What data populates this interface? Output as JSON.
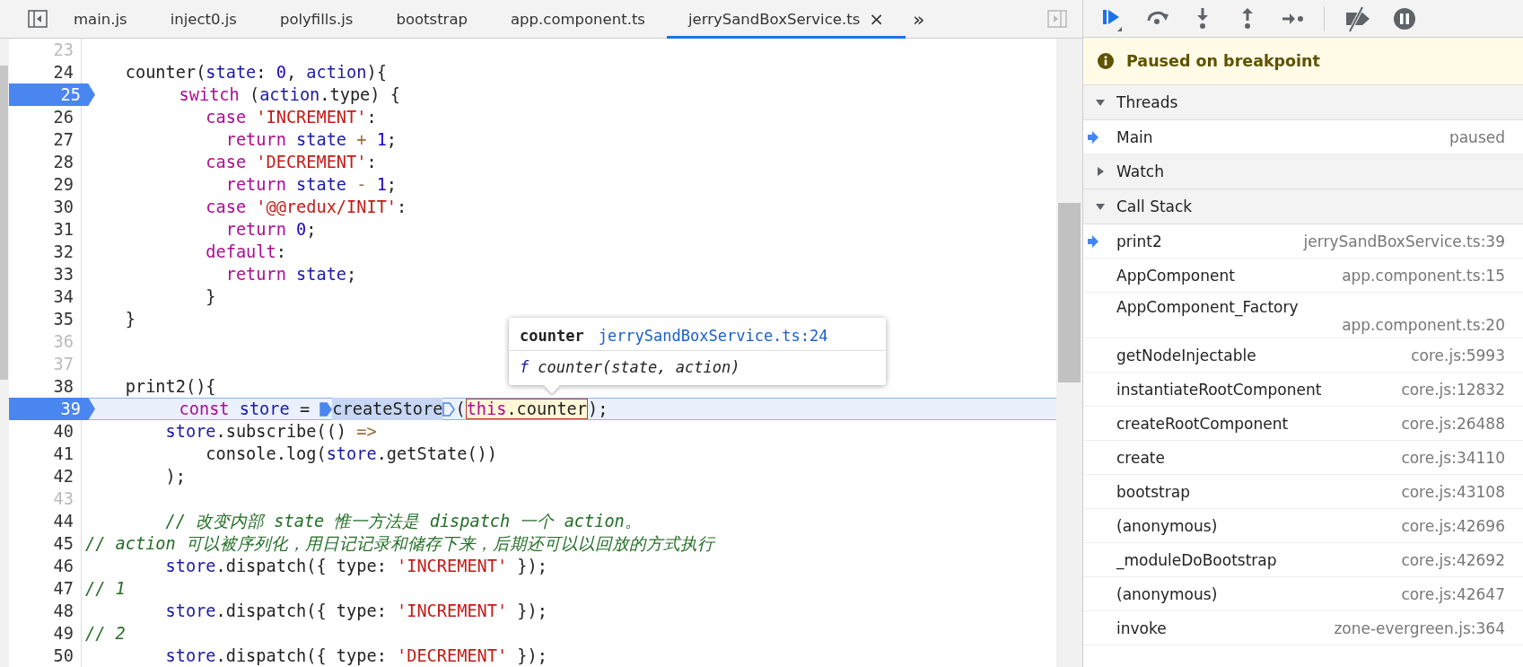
{
  "tabs": [
    {
      "label": "main.js",
      "selected": false
    },
    {
      "label": "inject0.js",
      "selected": false
    },
    {
      "label": "polyfills.js",
      "selected": false
    },
    {
      "label": "bootstrap",
      "selected": false
    },
    {
      "label": "app.component.ts",
      "selected": false
    },
    {
      "label": "jerrySandBoxService.ts",
      "selected": true
    }
  ],
  "tab_close": "×",
  "tab_overflow": "»",
  "code_lines": [
    {
      "number": "23",
      "dim": true,
      "breakpoint": false,
      "current": false
    },
    {
      "number": "24",
      "dim": false,
      "breakpoint": false,
      "current": false,
      "tokens": [
        {
          "kind": "plain",
          "text": "    counter("
        },
        {
          "kind": "variable",
          "text": "state"
        },
        {
          "kind": "plain",
          "text": ": "
        },
        {
          "kind": "number",
          "text": "0"
        },
        {
          "kind": "plain",
          "text": ", "
        },
        {
          "kind": "variable",
          "text": "action"
        },
        {
          "kind": "plain",
          "text": "){"
        }
      ]
    },
    {
      "number": "25",
      "dim": false,
      "breakpoint": true,
      "current": false,
      "tokens": [
        {
          "kind": "keyword",
          "text": "        switch"
        },
        {
          "kind": "plain",
          "text": " ("
        },
        {
          "kind": "variable",
          "text": "action"
        },
        {
          "kind": "plain",
          "text": ".type) {"
        }
      ]
    },
    {
      "number": "26",
      "dim": false,
      "breakpoint": false,
      "current": false,
      "tokens": [
        {
          "kind": "keyword",
          "text": "            case"
        },
        {
          "kind": "string",
          "text": " 'INCREMENT'"
        },
        {
          "kind": "plain",
          "text": ":"
        }
      ]
    },
    {
      "number": "27",
      "dim": false,
      "breakpoint": false,
      "current": false,
      "tokens": [
        {
          "kind": "keyword",
          "text": "              return"
        },
        {
          "kind": "variable",
          "text": " state"
        },
        {
          "kind": "operator",
          "text": " +"
        },
        {
          "kind": "number",
          "text": " 1"
        },
        {
          "kind": "plain",
          "text": ";"
        }
      ]
    },
    {
      "number": "28",
      "dim": false,
      "breakpoint": false,
      "current": false,
      "tokens": [
        {
          "kind": "keyword",
          "text": "            case"
        },
        {
          "kind": "string",
          "text": " 'DECREMENT'"
        },
        {
          "kind": "plain",
          "text": ":"
        }
      ]
    },
    {
      "number": "29",
      "dim": false,
      "breakpoint": false,
      "current": false,
      "tokens": [
        {
          "kind": "keyword",
          "text": "              return"
        },
        {
          "kind": "variable",
          "text": " state"
        },
        {
          "kind": "operator",
          "text": " -"
        },
        {
          "kind": "number",
          "text": " 1"
        },
        {
          "kind": "plain",
          "text": ";"
        }
      ]
    },
    {
      "number": "30",
      "dim": false,
      "breakpoint": false,
      "current": false,
      "tokens": [
        {
          "kind": "keyword",
          "text": "            case"
        },
        {
          "kind": "string",
          "text": " '@@redux/INIT'"
        },
        {
          "kind": "plain",
          "text": ":"
        }
      ]
    },
    {
      "number": "31",
      "dim": false,
      "breakpoint": false,
      "current": false,
      "tokens": [
        {
          "kind": "keyword",
          "text": "              return"
        },
        {
          "kind": "number",
          "text": " 0"
        },
        {
          "kind": "plain",
          "text": ";"
        }
      ]
    },
    {
      "number": "32",
      "dim": false,
      "breakpoint": false,
      "current": false,
      "tokens": [
        {
          "kind": "keyword",
          "text": "            default"
        },
        {
          "kind": "plain",
          "text": ":"
        }
      ]
    },
    {
      "number": "33",
      "dim": false,
      "breakpoint": false,
      "current": false,
      "tokens": [
        {
          "kind": "keyword",
          "text": "              return"
        },
        {
          "kind": "variable",
          "text": " state"
        },
        {
          "kind": "plain",
          "text": ";"
        }
      ]
    },
    {
      "number": "34",
      "dim": false,
      "breakpoint": false,
      "current": false,
      "tokens": [
        {
          "kind": "plain",
          "text": "            }"
        }
      ]
    },
    {
      "number": "35",
      "dim": false,
      "breakpoint": false,
      "current": false,
      "tokens": [
        {
          "kind": "plain",
          "text": "    }"
        }
      ]
    },
    {
      "number": "36",
      "dim": true,
      "breakpoint": false,
      "current": false
    },
    {
      "number": "37",
      "dim": true,
      "breakpoint": false,
      "current": false
    },
    {
      "number": "38",
      "dim": false,
      "breakpoint": false,
      "current": false,
      "tokens": [
        {
          "kind": "plain",
          "text": "    print2(){"
        }
      ]
    },
    {
      "number": "39",
      "dim": false,
      "breakpoint": true,
      "current": true,
      "tokens": [
        {
          "kind": "keyword",
          "text": "        const"
        },
        {
          "kind": "variable",
          "text": " store"
        },
        {
          "kind": "plain",
          "text": " = "
        },
        {
          "kind": "breakpoint_marker",
          "active": true
        },
        {
          "kind": "plain",
          "text": "createStore",
          "highlighted": true
        },
        {
          "kind": "breakpoint_marker",
          "active": false
        },
        {
          "kind": "plain",
          "text": "("
        },
        {
          "kind": "hovered",
          "parts": [
            {
              "kind": "keyword",
              "text": "this"
            },
            {
              "kind": "plain",
              "text": ".counter"
            }
          ]
        },
        {
          "kind": "plain",
          "text": ");"
        }
      ]
    },
    {
      "number": "40",
      "dim": false,
      "breakpoint": false,
      "current": false,
      "tokens": [
        {
          "kind": "variable",
          "text": "        store"
        },
        {
          "kind": "plain",
          "text": ".subscribe(() "
        },
        {
          "kind": "operator",
          "text": "=>"
        }
      ]
    },
    {
      "number": "41",
      "dim": false,
      "breakpoint": false,
      "current": false,
      "tokens": [
        {
          "kind": "plain",
          "text": "            console.log("
        },
        {
          "kind": "variable",
          "text": "store"
        },
        {
          "kind": "plain",
          "text": ".getState())"
        }
      ]
    },
    {
      "number": "42",
      "dim": false,
      "breakpoint": false,
      "current": false,
      "tokens": [
        {
          "kind": "plain",
          "text": "        );"
        }
      ]
    },
    {
      "number": "43",
      "dim": true,
      "breakpoint": false,
      "current": false
    },
    {
      "number": "44",
      "dim": false,
      "breakpoint": false,
      "current": false,
      "tokens": [
        {
          "kind": "comment",
          "text": "        // 改变内部 state 惟一方法是 dispatch 一个 action。"
        }
      ]
    },
    {
      "number": "45",
      "dim": false,
      "breakpoint": false,
      "current": false,
      "tokens": [
        {
          "kind": "comment",
          "text": "// action 可以被序列化，用日记记录和储存下来，后期还可以以回放的方式执行"
        }
      ]
    },
    {
      "number": "46",
      "dim": false,
      "breakpoint": false,
      "current": false,
      "tokens": [
        {
          "kind": "variable",
          "text": "        store"
        },
        {
          "kind": "plain",
          "text": ".dispatch({ type: "
        },
        {
          "kind": "string",
          "text": "'INCREMENT'"
        },
        {
          "kind": "plain",
          "text": " });"
        }
      ]
    },
    {
      "number": "47",
      "dim": false,
      "breakpoint": false,
      "current": false,
      "tokens": [
        {
          "kind": "comment",
          "text": "// 1"
        }
      ]
    },
    {
      "number": "48",
      "dim": false,
      "breakpoint": false,
      "current": false,
      "tokens": [
        {
          "kind": "variable",
          "text": "        store"
        },
        {
          "kind": "plain",
          "text": ".dispatch({ type: "
        },
        {
          "kind": "string",
          "text": "'INCREMENT'"
        },
        {
          "kind": "plain",
          "text": " });"
        }
      ]
    },
    {
      "number": "49",
      "dim": false,
      "breakpoint": false,
      "current": false,
      "tokens": [
        {
          "kind": "comment",
          "text": "// 2"
        }
      ]
    },
    {
      "number": "50",
      "dim": false,
      "breakpoint": false,
      "current": false,
      "tokens": [
        {
          "kind": "variable",
          "text": "        store"
        },
        {
          "kind": "plain",
          "text": ".dispatch({ type: "
        },
        {
          "kind": "string",
          "text": "'DECREMENT'"
        },
        {
          "kind": "plain",
          "text": " });"
        }
      ]
    }
  ],
  "tooltip": {
    "name": "counter",
    "location": "jerrySandBoxService.ts:24",
    "function_mark": "f",
    "signature": "counter(state, action)"
  },
  "debugger": {
    "toolbar": [
      {
        "kind": "resume"
      },
      {
        "kind": "step_over"
      },
      {
        "kind": "step_into"
      },
      {
        "kind": "step_out"
      },
      {
        "kind": "step"
      },
      {
        "kind": "separator"
      },
      {
        "kind": "deactivate"
      },
      {
        "kind": "pause_exceptions"
      }
    ],
    "banner": "Paused on breakpoint",
    "sections": [
      {
        "title": "Threads",
        "expanded": true,
        "items": [
          {
            "name": "Main",
            "detail": "paused",
            "current": true
          }
        ]
      },
      {
        "title": "Watch",
        "expanded": false
      },
      {
        "title": "Call Stack",
        "expanded": true,
        "items": [
          {
            "name": "print2",
            "detail": "jerrySandBoxService.ts:39",
            "current": true
          },
          {
            "name": "AppComponent",
            "detail": "app.component.ts:15",
            "current": false
          },
          {
            "name": "AppComponent_Factory",
            "detail": "app.component.ts:20",
            "current": false
          },
          {
            "name": "getNodeInjectable",
            "detail": "core.js:5993",
            "current": false
          },
          {
            "name": "instantiateRootComponent",
            "detail": "core.js:12832",
            "current": false
          },
          {
            "name": "createRootComponent",
            "detail": "core.js:26488",
            "current": false
          },
          {
            "name": "create",
            "detail": "core.js:34110",
            "current": false
          },
          {
            "name": "bootstrap",
            "detail": "core.js:43108",
            "current": false
          },
          {
            "name": "(anonymous)",
            "detail": "core.js:42696",
            "current": false
          },
          {
            "name": "_moduleDoBootstrap",
            "detail": "core.js:42692",
            "current": false
          },
          {
            "name": "(anonymous)",
            "detail": "core.js:42647",
            "current": false
          },
          {
            "name": "invoke",
            "detail": "zone-evergreen.js:364",
            "current": false
          }
        ]
      }
    ]
  }
}
